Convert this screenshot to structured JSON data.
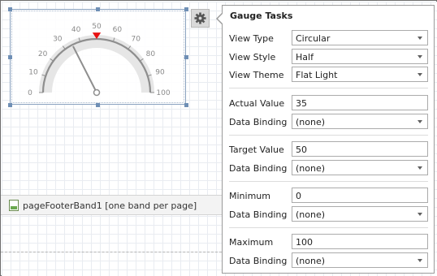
{
  "gauge": {
    "scale_min": 0,
    "scale_max": 100,
    "tick_labels": [
      "0",
      "10",
      "20",
      "30",
      "40",
      "50",
      "60",
      "70",
      "80",
      "90",
      "100"
    ],
    "actual_value": 35,
    "target_value": 50,
    "colors": {
      "arc": "#e6e6e6",
      "scale": "#8e8e8e",
      "needle": "#8e8e8e",
      "target_marker": "#e81010"
    }
  },
  "smart_tag": {
    "icon": "gear-icon"
  },
  "band": {
    "label": "pageFooterBand1 [one band per page]",
    "icon": "band-icon"
  },
  "panel": {
    "title": "Gauge Tasks",
    "view_type": {
      "label": "View Type",
      "value": "Circular"
    },
    "view_style": {
      "label": "View Style",
      "value": "Half"
    },
    "view_theme": {
      "label": "View Theme",
      "value": "Flat Light"
    },
    "actual_value": {
      "label": "Actual Value",
      "value": "35"
    },
    "actual_binding": {
      "label": "Data Binding",
      "value": "(none)"
    },
    "target_value": {
      "label": "Target Value",
      "value": "50"
    },
    "target_binding": {
      "label": "Data Binding",
      "value": "(none)"
    },
    "minimum": {
      "label": "Minimum",
      "value": "0"
    },
    "minimum_binding": {
      "label": "Data Binding",
      "value": "(none)"
    },
    "maximum": {
      "label": "Maximum",
      "value": "100"
    },
    "maximum_binding": {
      "label": "Data Binding",
      "value": "(none)"
    }
  }
}
